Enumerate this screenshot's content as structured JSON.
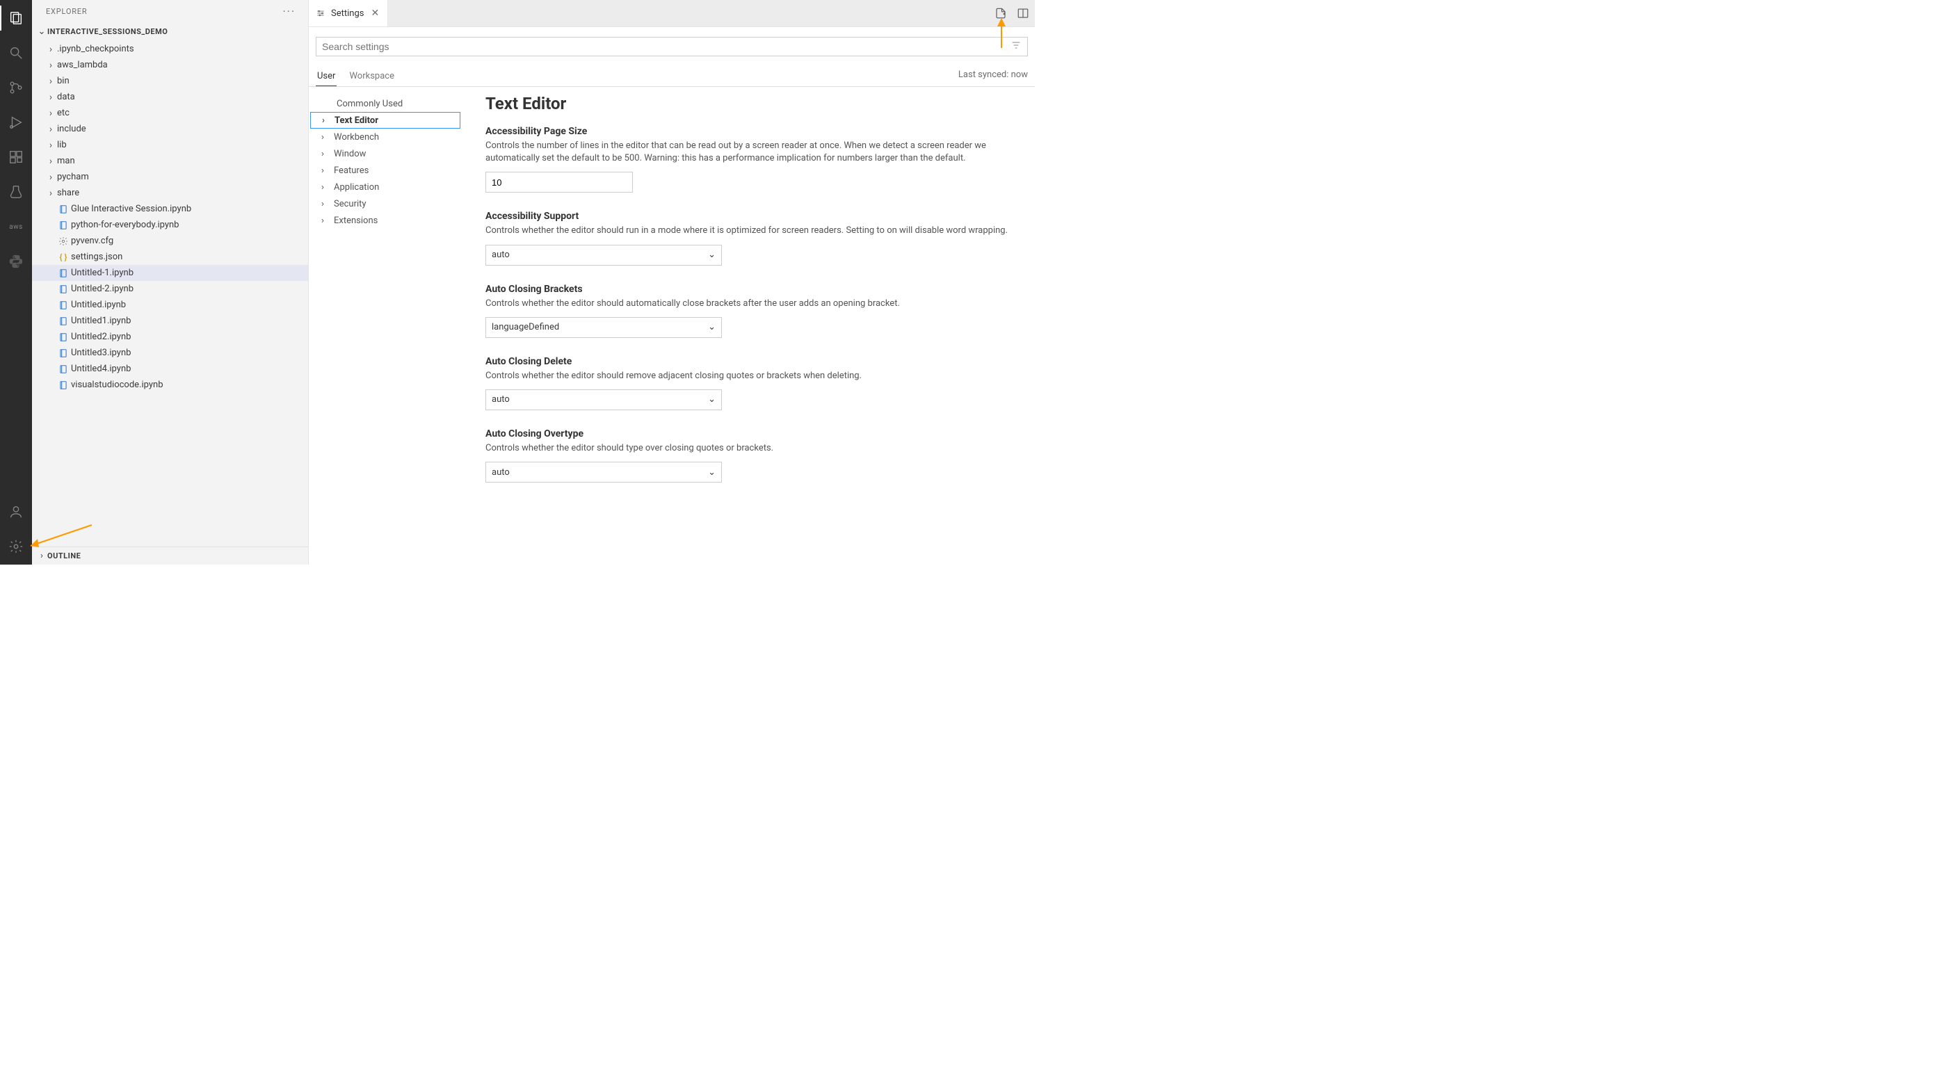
{
  "sidebar": {
    "title": "EXPLORER",
    "root": "INTERACTIVE_SESSIONS_DEMO",
    "folders": [
      ".ipynb_checkpoints",
      "aws_lambda",
      "bin",
      "data",
      "etc",
      "include",
      "lib",
      "man",
      "pycham",
      "share"
    ],
    "files": [
      {
        "name": "Glue Interactive Session.ipynb",
        "icon": "notebook"
      },
      {
        "name": "python-for-everybody.ipynb",
        "icon": "notebook"
      },
      {
        "name": "pyvenv.cfg",
        "icon": "gear"
      },
      {
        "name": "settings.json",
        "icon": "json"
      },
      {
        "name": "Untitled-1.ipynb",
        "icon": "notebook",
        "selected": true
      },
      {
        "name": "Untitled-2.ipynb",
        "icon": "notebook"
      },
      {
        "name": "Untitled.ipynb",
        "icon": "notebook"
      },
      {
        "name": "Untitled1.ipynb",
        "icon": "notebook"
      },
      {
        "name": "Untitled2.ipynb",
        "icon": "notebook"
      },
      {
        "name": "Untitled3.ipynb",
        "icon": "notebook"
      },
      {
        "name": "Untitled4.ipynb",
        "icon": "notebook"
      },
      {
        "name": "visualstudiocode.ipynb",
        "icon": "notebook"
      }
    ],
    "outline": "OUTLINE"
  },
  "tab": {
    "label": "Settings"
  },
  "search": {
    "placeholder": "Search settings"
  },
  "scope": {
    "user": "User",
    "workspace": "Workspace",
    "sync": "Last synced: now"
  },
  "nav": {
    "common": "Commonly Used",
    "textEditor": "Text Editor",
    "workbench": "Workbench",
    "window": "Window",
    "features": "Features",
    "application": "Application",
    "security": "Security",
    "extensions": "Extensions"
  },
  "settings": {
    "heading": "Text Editor",
    "s1": {
      "title": "Accessibility Page Size",
      "desc": "Controls the number of lines in the editor that can be read out by a screen reader at once. When we detect a screen reader we automatically set the default to be 500. Warning: this has a performance implication for numbers larger than the default.",
      "value": "10"
    },
    "s2": {
      "title": "Accessibility Support",
      "desc": "Controls whether the editor should run in a mode where it is optimized for screen readers. Setting to on will disable word wrapping.",
      "value": "auto"
    },
    "s3": {
      "title": "Auto Closing Brackets",
      "desc": "Controls whether the editor should automatically close brackets after the user adds an opening bracket.",
      "value": "languageDefined"
    },
    "s4": {
      "title": "Auto Closing Delete",
      "desc": "Controls whether the editor should remove adjacent closing quotes or brackets when deleting.",
      "value": "auto"
    },
    "s5": {
      "title": "Auto Closing Overtype",
      "desc": "Controls whether the editor should type over closing quotes or brackets.",
      "value": "auto"
    }
  },
  "aws_label": "aws"
}
